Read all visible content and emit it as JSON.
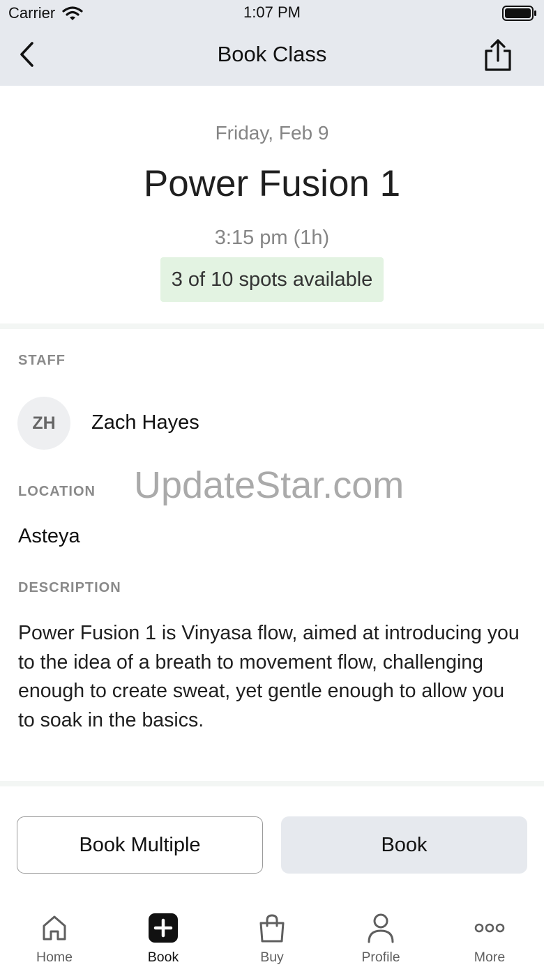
{
  "status_bar": {
    "carrier": "Carrier",
    "time": "1:07 PM"
  },
  "nav": {
    "title": "Book Class"
  },
  "class_info": {
    "date": "Friday, Feb 9",
    "name": "Power Fusion 1",
    "time": "3:15 pm (1h)",
    "availability": "3 of 10 spots available"
  },
  "staff": {
    "label": "STAFF",
    "initials": "ZH",
    "name": "Zach Hayes"
  },
  "location": {
    "label": "LOCATION",
    "name": "Asteya"
  },
  "watermark": "UpdateStar.com",
  "description": {
    "label": "DESCRIPTION",
    "text": "Power Fusion 1 is Vinyasa flow, aimed at introducing you to the idea of a breath to movement flow, challenging enough to create sweat, yet gentle enough to allow you to soak in the basics."
  },
  "actions": {
    "book_multiple": "Book Multiple",
    "book": "Book"
  },
  "tabs": [
    {
      "label": "Home",
      "icon": "home-icon"
    },
    {
      "label": "Book",
      "icon": "plus-square-icon",
      "active": true
    },
    {
      "label": "Buy",
      "icon": "shopping-bag-icon"
    },
    {
      "label": "Profile",
      "icon": "user-icon"
    },
    {
      "label": "More",
      "icon": "more-dots-icon"
    }
  ],
  "colors": {
    "header_bg": "#e6e9ee",
    "badge_bg": "#e3f3e2",
    "muted_text": "#858585"
  }
}
